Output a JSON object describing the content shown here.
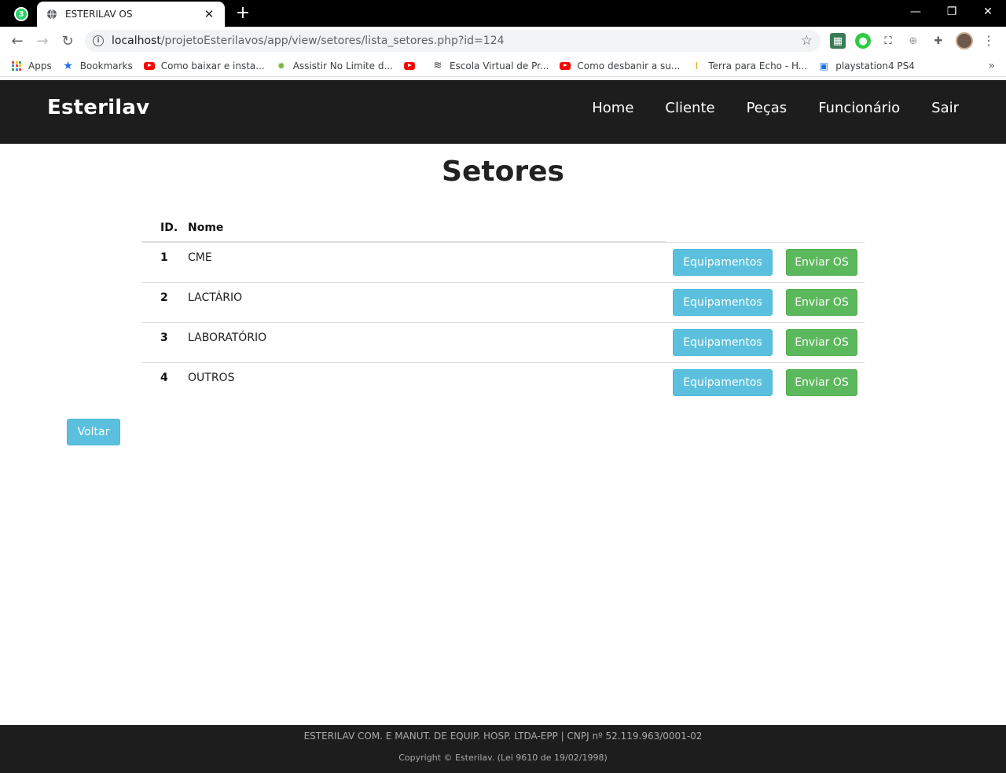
{
  "browser": {
    "pinned_tab_badge": "3",
    "tab_title": "ESTERILAV OS",
    "url_host": "localhost",
    "url_path": "/projetoEsterilavos/app/view/setores/lista_setores.php?id=124",
    "bookmarks": [
      {
        "label": "Apps",
        "icon": "apps-grid-icon"
      },
      {
        "label": "Bookmarks",
        "icon": "star-icon"
      },
      {
        "label": "Como baixar e insta...",
        "icon": "youtube-icon"
      },
      {
        "label": "Assistir No Limite d...",
        "icon": "play-icon"
      },
      {
        "label": "",
        "icon": "youtube-icon"
      },
      {
        "label": "Escola Virtual de Pr...",
        "icon": "flag-icon"
      },
      {
        "label": "Como desbanir a su...",
        "icon": "youtube-icon"
      },
      {
        "label": "Terra para Echo - H...",
        "icon": "trophy-icon"
      },
      {
        "label": "playstation4 PS4",
        "icon": "shopping-bag-icon"
      }
    ]
  },
  "site": {
    "brand": "Esterilav",
    "menu": [
      "Home",
      "Cliente",
      "Peças",
      "Funcionário",
      "Sair"
    ],
    "page_title": "Setores",
    "table": {
      "headers": {
        "id": "ID.",
        "nome": "Nome"
      },
      "rows": [
        {
          "id": "1",
          "nome": "CME"
        },
        {
          "id": "2",
          "nome": "LACTÁRIO"
        },
        {
          "id": "3",
          "nome": "LABORATÓRIO"
        },
        {
          "id": "4",
          "nome": "OUTROS"
        }
      ],
      "equip_label": "Equipamentos",
      "enviar_label": "Enviar OS"
    },
    "back_label": "Voltar",
    "footer_line1": "ESTERILAV COM. E MANUT. DE EQUIP. HOSP. LTDA-EPP | CNPJ nº 52.119.963/0001-02",
    "footer_line2": "Copyright © Esterilav. (Lei 9610 de 19/02/1998)"
  },
  "colors": {
    "nav_bg": "#1d1d1d",
    "btn_info": "#5bc0de",
    "btn_success": "#5cb85c"
  }
}
